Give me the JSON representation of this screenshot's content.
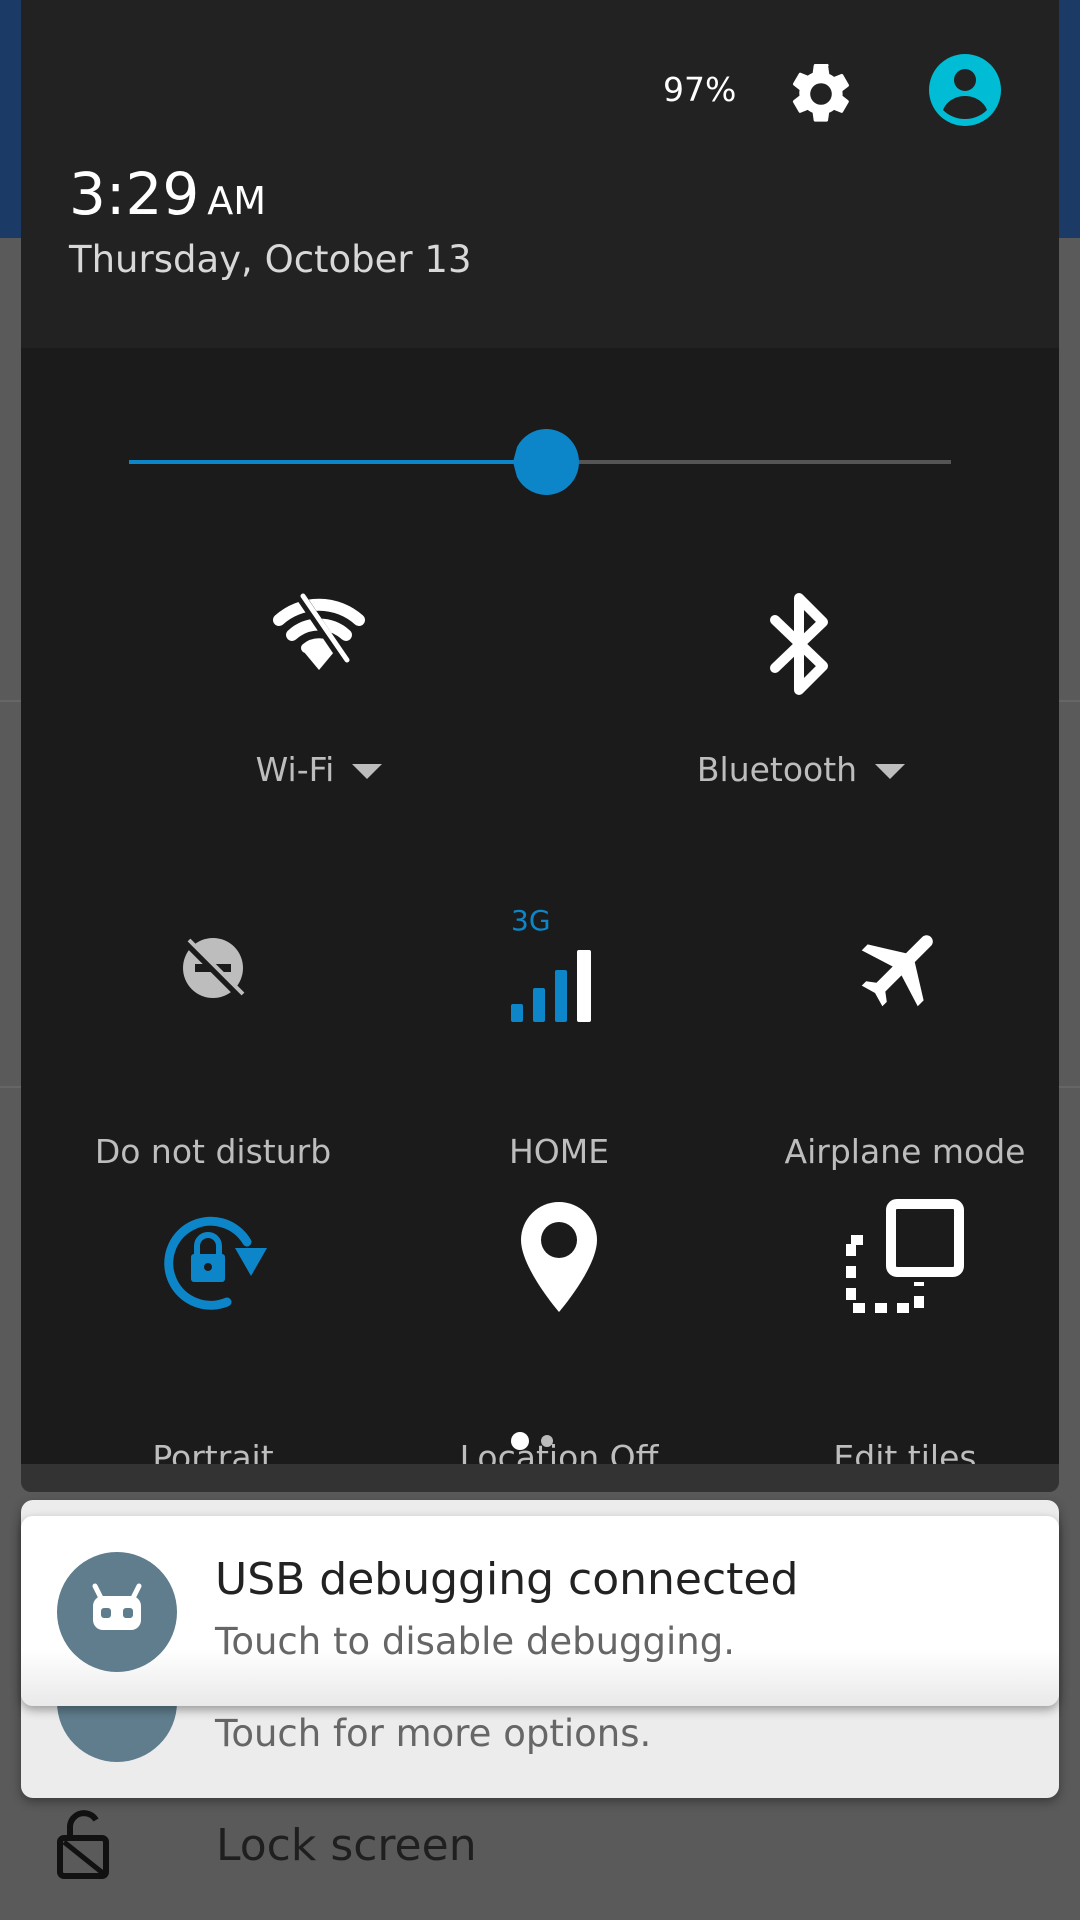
{
  "header": {
    "battery": "97%",
    "time": "3:29",
    "ampm": "AM",
    "date": "Thursday, October 13"
  },
  "brightness": {
    "level": 0.49
  },
  "tiles": {
    "wifi": {
      "label": "Wi-Fi",
      "icon": "wifi-off-icon"
    },
    "bluetooth": {
      "label": "Bluetooth",
      "icon": "bluetooth-icon"
    },
    "dnd": {
      "label": "Do not disturb",
      "icon": "do-not-disturb-off-icon"
    },
    "cellular": {
      "label": "HOME",
      "badge": "3G",
      "icon": "cellular-signal-icon"
    },
    "airplane": {
      "label": "Airplane mode",
      "icon": "airplane-icon"
    },
    "rotation": {
      "label": "Portrait",
      "icon": "rotation-lock-icon"
    },
    "location": {
      "label": "Location Off",
      "icon": "location-pin-icon"
    },
    "edit": {
      "label": "Edit tiles",
      "icon": "edit-tiles-icon"
    }
  },
  "pager": {
    "pages": 2,
    "current": 1
  },
  "notifications": [
    {
      "title": "USB debugging connected",
      "text": "Touch to disable debugging."
    },
    {
      "text": "Touch for more options."
    }
  ],
  "lock": {
    "label": "Lock screen"
  },
  "colors": {
    "accent": "#0d86c9",
    "avatar": "#00bcd4",
    "panel": "#1b1b1b",
    "header": "#222222"
  }
}
